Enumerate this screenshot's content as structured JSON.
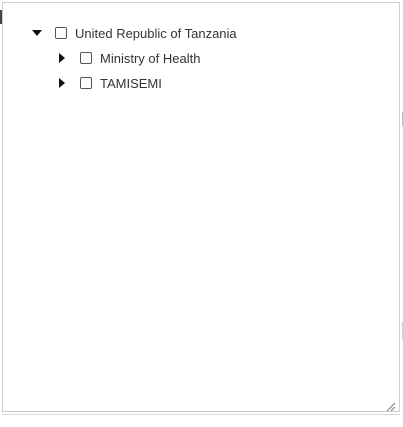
{
  "tree": {
    "root": {
      "label": "United Republic of Tanzania",
      "expanded": true,
      "toggle_icon": "caret-down-icon",
      "children": [
        {
          "label": "Ministry of Health",
          "expanded": false,
          "toggle_icon": "caret-right-icon"
        },
        {
          "label": "TAMISEMI",
          "expanded": false,
          "toggle_icon": "caret-right-icon"
        }
      ]
    }
  },
  "colors": {
    "text": "#333333",
    "checkbox_border": "#555555",
    "panel_border": "#d0d0d0"
  }
}
